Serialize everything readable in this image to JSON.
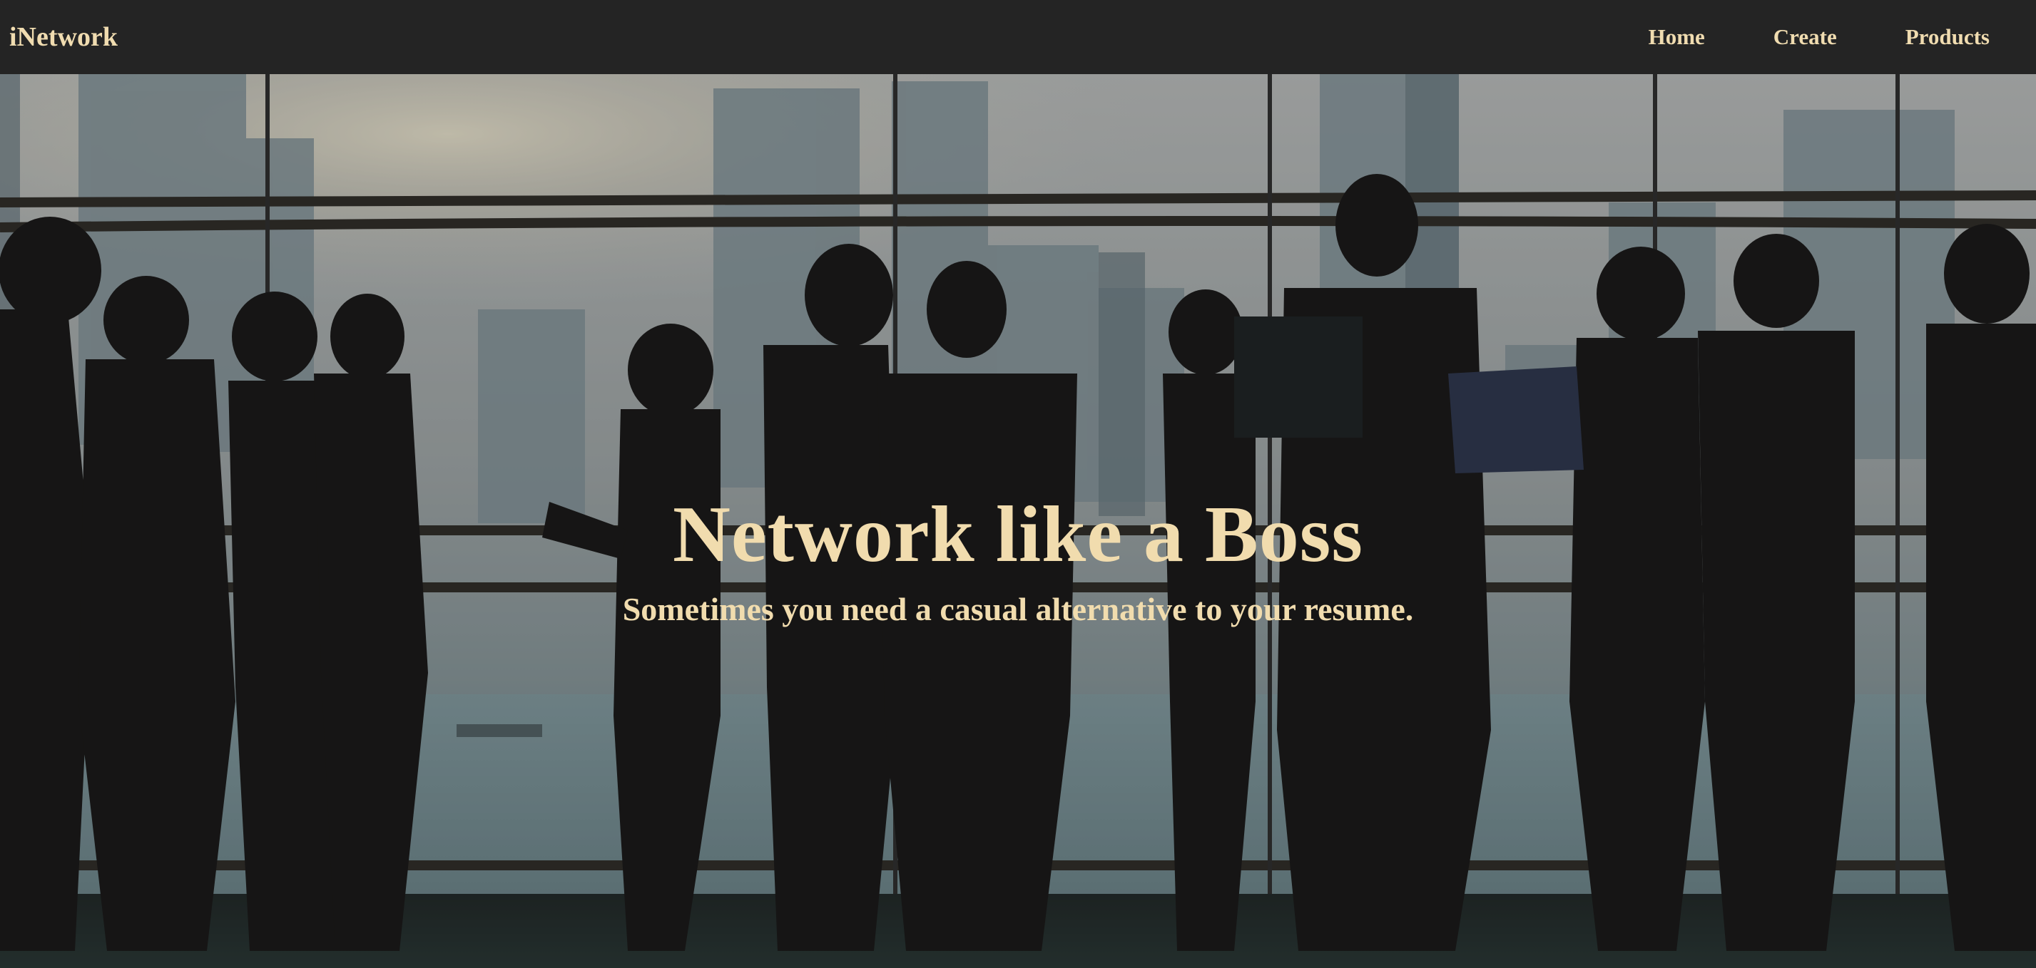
{
  "navbar": {
    "brand": "iNetwork",
    "links": [
      {
        "label": "Home"
      },
      {
        "label": "Create"
      },
      {
        "label": "Products"
      }
    ]
  },
  "hero": {
    "title": "Network like a Boss",
    "subtitle": "Sometimes you need a casual alternative to your resume.",
    "background_image": "silhouettes-of-business-people-networking-in-front-of-city-skyline-window"
  },
  "colors": {
    "navbar_bg": "#242424",
    "accent_text": "#f0dcb0",
    "overlay": "#1c1c1c"
  }
}
